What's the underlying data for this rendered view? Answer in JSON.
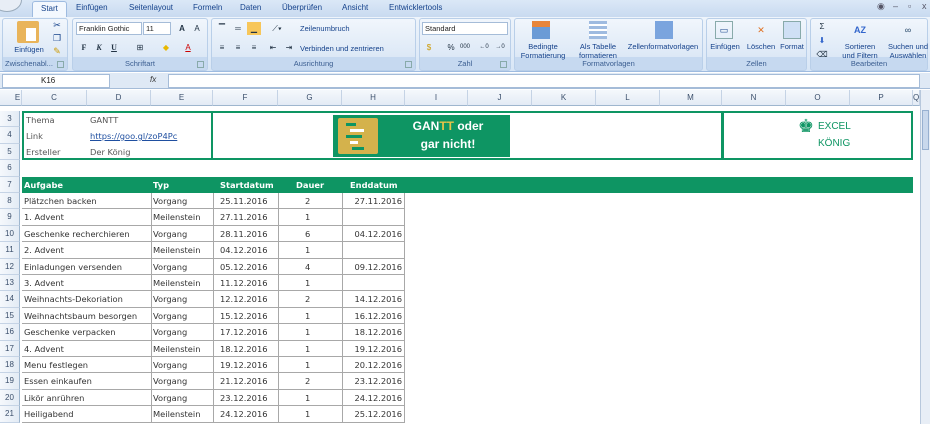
{
  "tabs": [
    "Start",
    "Einfügen",
    "Seitenlayout",
    "Formeln",
    "Daten",
    "Überprüfen",
    "Ansicht",
    "Entwicklertools"
  ],
  "ribbon": {
    "clipboard": {
      "paste": "Einfügen",
      "label": "Zwischenabl..."
    },
    "font": {
      "name": "Franklin Gothic",
      "size": "11",
      "bold": "F",
      "italic": "K",
      "underline": "U",
      "label": "Schriftart"
    },
    "alignment": {
      "wrap": "Zeilenumbruch",
      "merge": "Verbinden und zentrieren",
      "label": "Ausrichtung"
    },
    "number": {
      "format": "Standard",
      "percent": "%",
      "thousands": "000",
      "label": "Zahl"
    },
    "styles": {
      "conditional": [
        "Bedingte",
        "Formatierung"
      ],
      "table": [
        "Als Tabelle",
        "formatieren"
      ],
      "cellstyles": "Zellenformatvorlagen",
      "label": "Formatvorlagen"
    },
    "cells": {
      "insert": "Einfügen",
      "delete": "Löschen",
      "format": "Format",
      "label": "Zellen"
    },
    "editing": {
      "sort": [
        "Sortieren",
        "und Filtern"
      ],
      "find": [
        "Suchen und",
        "Auswählen"
      ],
      "label": "Bearbeiten"
    }
  },
  "formula_bar": {
    "name_box": "K16",
    "fx": "fx",
    "value": ""
  },
  "columns": [
    "E",
    "C",
    "D",
    "E",
    "F",
    "G",
    "H",
    "I",
    "J",
    "K",
    "L",
    "M",
    "N",
    "O",
    "P",
    "Q"
  ],
  "rows": [
    "3",
    "4",
    "5",
    "6",
    "7",
    "8",
    "9",
    "10",
    "11",
    "12",
    "13",
    "14",
    "15",
    "16",
    "17",
    "18",
    "19",
    "20",
    "21"
  ],
  "info": {
    "thema_label": "Thema",
    "thema": "GANTT",
    "link_label": "Link",
    "link": "https://goo.gl/zoP4Pc",
    "ersteller_label": "Ersteller",
    "ersteller": "Der König"
  },
  "banner": {
    "line1a": "GAN",
    "line1b": "TT",
    "line1c": " oder",
    "line2": "gar nicht!"
  },
  "logo": {
    "line1": "EXCEL",
    "line2": "KÖNIG"
  },
  "colors": {
    "accent": "#0e9563",
    "gold": "#d4b24c"
  },
  "table": {
    "headers": [
      "Aufgabe",
      "Typ",
      "Startdatum",
      "Dauer",
      "Enddatum"
    ],
    "rows": [
      [
        "Plätzchen backen",
        "Vorgang",
        "25.11.2016",
        "2",
        "27.11.2016"
      ],
      [
        "1. Advent",
        "Meilenstein",
        "27.11.2016",
        "1",
        ""
      ],
      [
        "Geschenke recherchieren",
        "Vorgang",
        "28.11.2016",
        "6",
        "04.12.2016"
      ],
      [
        "2. Advent",
        "Meilenstein",
        "04.12.2016",
        "1",
        ""
      ],
      [
        "Einladungen versenden",
        "Vorgang",
        "05.12.2016",
        "4",
        "09.12.2016"
      ],
      [
        "3. Advent",
        "Meilenstein",
        "11.12.2016",
        "1",
        ""
      ],
      [
        "Weihnachts-Dekoriation",
        "Vorgang",
        "12.12.2016",
        "2",
        "14.12.2016"
      ],
      [
        "Weihnachtsbaum besorgen",
        "Vorgang",
        "15.12.2016",
        "1",
        "16.12.2016"
      ],
      [
        "Geschenke verpacken",
        "Vorgang",
        "17.12.2016",
        "1",
        "18.12.2016"
      ],
      [
        "4. Advent",
        "Meilenstein",
        "18.12.2016",
        "1",
        "19.12.2016"
      ],
      [
        "Menu festlegen",
        "Vorgang",
        "19.12.2016",
        "1",
        "20.12.2016"
      ],
      [
        "Essen einkaufen",
        "Vorgang",
        "21.12.2016",
        "2",
        "23.12.2016"
      ],
      [
        "Likör anrühren",
        "Vorgang",
        "23.12.2016",
        "1",
        "24.12.2016"
      ],
      [
        "Heiligabend",
        "Meilenstein",
        "24.12.2016",
        "1",
        "25.12.2016"
      ]
    ]
  }
}
